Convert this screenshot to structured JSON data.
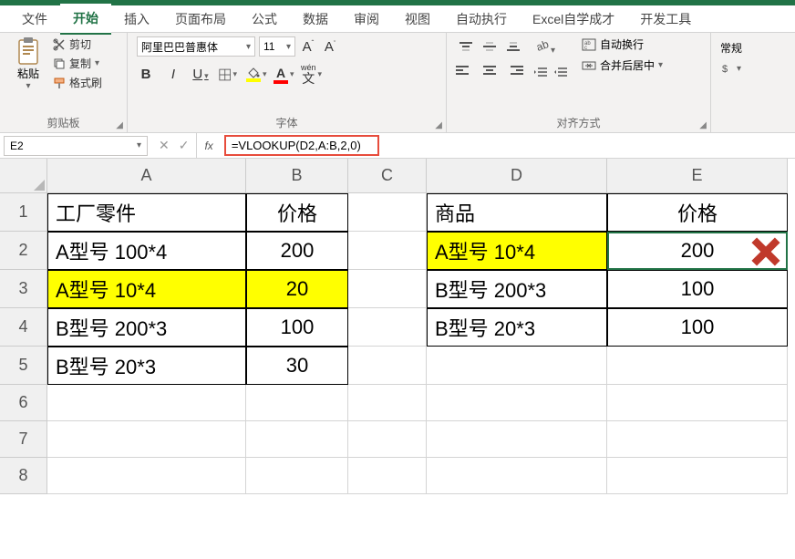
{
  "menu": {
    "items": [
      "文件",
      "开始",
      "插入",
      "页面布局",
      "公式",
      "数据",
      "审阅",
      "视图",
      "自动执行",
      "Excel自学成才",
      "开发工具"
    ],
    "active_index": 1
  },
  "ribbon": {
    "clipboard": {
      "paste": "粘贴",
      "cut": "剪切",
      "copy": "复制",
      "format_painter": "格式刷",
      "group_label": "剪贴板"
    },
    "font": {
      "name": "阿里巴巴普惠体",
      "size": "11",
      "bold": "B",
      "italic": "I",
      "underline": "U",
      "wen": "wén",
      "group_label": "字体"
    },
    "alignment": {
      "wrap": "自动换行",
      "merge": "合并后居中",
      "group_label": "对齐方式"
    },
    "number": {
      "general": "常规"
    }
  },
  "formula_bar": {
    "cell_ref": "E2",
    "fx": "fx",
    "formula": "=VLOOKUP(D2,A:B,2,0)"
  },
  "columns": [
    "A",
    "B",
    "C",
    "D",
    "E"
  ],
  "rows": [
    "1",
    "2",
    "3",
    "4",
    "5",
    "6",
    "7",
    "8"
  ],
  "cells": {
    "A1": "工厂零件",
    "B1": "价格",
    "A2": "A型号 100*4",
    "B2": "200",
    "A3": "A型号 10*4",
    "B3": "20",
    "A4": "B型号 200*3",
    "B4": "100",
    "A5": "B型号 20*3",
    "B5": "30",
    "D1": "商品",
    "E1": "价格",
    "D2": "A型号 10*4",
    "E2": "200",
    "D3": "B型号 200*3",
    "E3": "100",
    "D4": "B型号 20*3",
    "E4": "100"
  }
}
